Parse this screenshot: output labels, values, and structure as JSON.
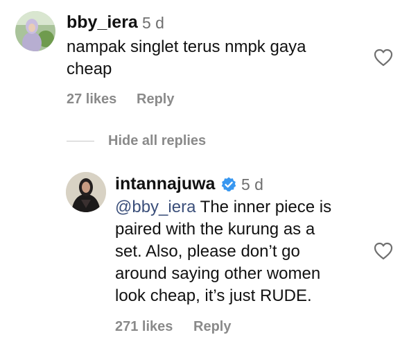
{
  "comment": {
    "username": "bby_iera",
    "time": "5 d",
    "text_lines": [
      "nampak singlet terus nmpk gaya",
      "cheap"
    ],
    "likes": "27 likes",
    "reply_label": "Reply",
    "like_icon": "heart-outline-icon"
  },
  "replies_toggle": {
    "label": "Hide all replies"
  },
  "reply": {
    "username": "intannajuwa",
    "verified": true,
    "verified_icon": "verified-badge-icon",
    "verified_color": "#3897f0",
    "time": "5 d",
    "mention": "@bby_iera",
    "text_first_rest": " The inner piece is",
    "text_lines": [
      "paired with the kurung as a",
      "set. Also, please don’t go",
      "around saying other women",
      "look cheap, it’s just RUDE."
    ],
    "likes": "271 likes",
    "reply_label": "Reply",
    "like_icon": "heart-outline-icon"
  }
}
